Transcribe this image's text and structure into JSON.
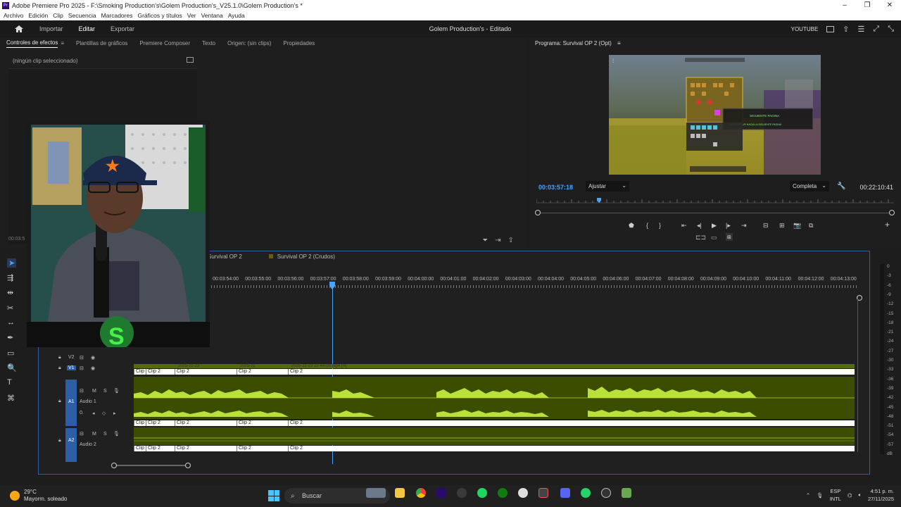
{
  "window": {
    "title": "Adobe Premiere Pro 2025 - F:\\Smoking Production's\\Golem Production's_V25.1.0\\Golem Production's *",
    "controls": [
      "–",
      "❐",
      "✕"
    ]
  },
  "menu": [
    "Archivo",
    "Edición",
    "Clip",
    "Secuencia",
    "Marcadores",
    "Gráficos y títulos",
    "Ver",
    "Ventana",
    "Ayuda"
  ],
  "appbar": {
    "tabs": [
      "Importar",
      "Editar",
      "Exportar"
    ],
    "active_tab": "Editar",
    "project_title": "Golem Production's - Editado",
    "workspace": "YOUTUBE"
  },
  "effect_panel": {
    "tabs": [
      "Controles de efectos",
      "Plantillas de gráficos",
      "Premiere Composer",
      "Texto",
      "Origen: (sin clips)",
      "Propiedades"
    ],
    "active_tab": "Controles de efectos",
    "no_clip": "(ningún clip seleccionado)",
    "left_timecode": "00:03:5"
  },
  "program": {
    "header": "Programa: Survival OP 2 (Opt)",
    "timecode": "00:03:57:18",
    "fit": "Ajustar",
    "quality": "Completa",
    "duration": "00:22:10:41",
    "overlay_text_1": "SIGUIENTE PAGINA",
    "overlay_text_2": "CLICK PARA IR HACIA LA SIGUIENTE PAGINA"
  },
  "timeline": {
    "sequence_tabs": [
      "Survival OP 2",
      "Survival OP 2 (Crudos)"
    ],
    "ruler_labels": [
      "00:03:54:00",
      "00:03:55:00",
      "00:03:56:00",
      "00:03:57:00",
      "00:03:58:00",
      "00:03:59:00",
      "00:04:00:00",
      "00:04:01:00",
      "00:04:02:00",
      "00:04:03:00",
      "00:04:04:00",
      "00:04:05:00",
      "00:04:06:00",
      "00:04:07:00",
      "00:04:08:00",
      "00:04:09:00",
      "00:04:10:00",
      "00:04:11:00",
      "00:04:12:00",
      "00:04:13:00"
    ],
    "tracks": {
      "v2": "V2",
      "v1": "V1",
      "a1": "A1",
      "a1_name": "Audio 1",
      "a2": "A2",
      "a2_name": "Audio 2",
      "m": "M",
      "s": "S"
    },
    "clips": [
      "Clip",
      "Clip 2",
      "Clip 2",
      "Clip 2",
      "Clip 2"
    ],
    "video_clip_labels": [
      "2025-11-23",
      "2025-11",
      "2025-11-23 22-44-09.mp4 [V]"
    ],
    "meter_labels": [
      "0",
      "-3",
      "-6",
      "-9",
      "-12",
      "-15",
      "-18",
      "-21",
      "-24",
      "-27",
      "-30",
      "-33",
      "-36",
      "-39",
      "-42",
      "-45",
      "-48",
      "-51",
      "-54",
      "-57",
      "dB"
    ]
  },
  "taskbar": {
    "temp": "29°C",
    "weather": "Mayorm. soleado",
    "search": "Buscar",
    "lang1": "ESP",
    "lang2": "INTL",
    "time": "4:51 p. m.",
    "date": "27/11/2025"
  }
}
